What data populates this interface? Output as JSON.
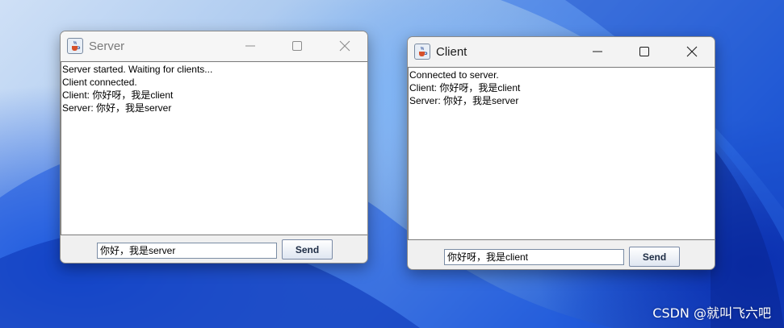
{
  "server_window": {
    "title": "Server",
    "log_lines": [
      "Server started. Waiting for clients...",
      "Client connected.",
      "Client: 你好呀，我是client",
      "Server: 你好，我是server"
    ],
    "input_value": "你好，我是server",
    "send_label": "Send",
    "state": "inactive"
  },
  "client_window": {
    "title": "Client",
    "log_lines": [
      "Connected to server.",
      "Client: 你好呀，我是client",
      "Server: 你好，我是server"
    ],
    "input_value": "你好呀，我是client",
    "send_label": "Send",
    "state": "active"
  },
  "watermark": "CSDN @就叫飞六吧",
  "icons": {
    "app": "java-coffee-cup-icon",
    "minimize": "minimize-icon",
    "maximize": "maximize-icon",
    "close": "close-icon"
  },
  "colors": {
    "desktop_accent": "#1d5be0",
    "window_bg": "#f0f0f0",
    "button_text": "#1d2c44"
  }
}
